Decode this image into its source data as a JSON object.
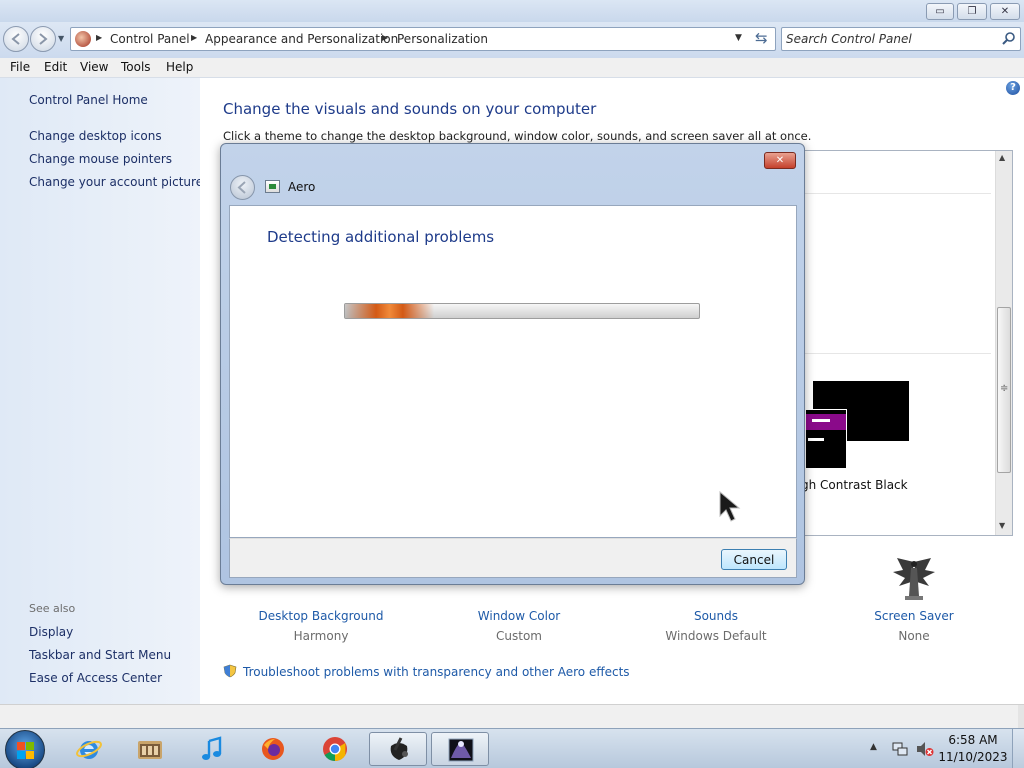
{
  "window": {
    "minimize_label": "▭",
    "maximize_label": "❐",
    "close_label": "✕"
  },
  "address": {
    "breadcrumbs": [
      "Control Panel",
      "Appearance and Personalization",
      "Personalization"
    ]
  },
  "search": {
    "placeholder": "Search Control Panel"
  },
  "menu": {
    "items": [
      "File",
      "Edit",
      "View",
      "Tools",
      "Help"
    ]
  },
  "left_pane": {
    "home": "Control Panel Home",
    "tasks": [
      "Change desktop icons",
      "Change mouse pointers",
      "Change your account picture"
    ],
    "see_also_label": "See also",
    "see_also": [
      "Display",
      "Taskbar and Start Menu",
      "Ease of Access Center"
    ]
  },
  "content": {
    "heading": "Change the visuals and sounds on your computer",
    "subtext": "Click a theme to change the desktop background, window color, sounds, and screen saver all at once.",
    "visible_theme": "gh Contrast Black",
    "settings": [
      {
        "label": "Desktop Background",
        "value": "Harmony"
      },
      {
        "label": "Window Color",
        "value": "Custom"
      },
      {
        "label": "Sounds",
        "value": "Windows Default"
      },
      {
        "label": "Screen Saver",
        "value": "None"
      }
    ],
    "troubleshoot_link": "Troubleshoot problems with transparency and other Aero effects"
  },
  "dialog": {
    "title": "Aero",
    "heading": "Detecting additional problems",
    "cancel_label": "Cancel",
    "close_label": "✕",
    "progress_fraction": 0.25
  },
  "taskbar": {
    "time": "6:58 AM",
    "date": "11/10/2023"
  },
  "colors": {
    "link_blue": "#1e5aa8",
    "heading_blue": "#1e3b8a",
    "progress_orange": "#d35a16"
  }
}
